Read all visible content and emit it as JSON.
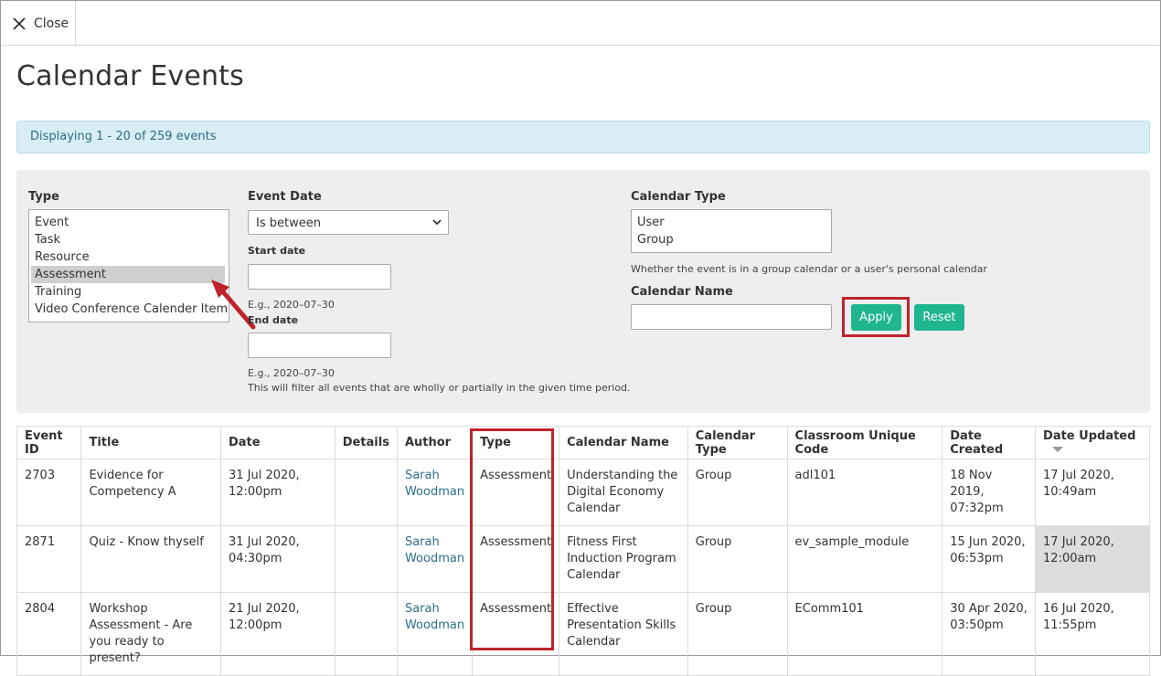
{
  "topbar": {
    "close_label": "Close"
  },
  "page_title": "Calendar Events",
  "info_text": "Displaying 1 - 20 of 259 events",
  "filters": {
    "type": {
      "label": "Type",
      "options": [
        "Event",
        "Task",
        "Resource",
        "Assessment",
        "Training",
        "Video Conference Calender Item"
      ],
      "selected": "Assessment"
    },
    "event_date": {
      "label": "Event Date",
      "operator": "Is between",
      "start_label": "Start date",
      "start_hint": "E.g., 2020–07–30",
      "end_label": "End date",
      "end_hint": "E.g., 2020–07–30",
      "note": "This will filter all events that are wholly or partially in the given time period."
    },
    "calendar_type": {
      "label": "Calendar Type",
      "options": [
        "User",
        "Group"
      ],
      "hint": "Whether the event is in a group calendar or a user's personal calendar"
    },
    "calendar_name": {
      "label": "Calendar Name",
      "value": ""
    },
    "apply_label": "Apply",
    "reset_label": "Reset"
  },
  "table": {
    "columns": [
      "Event ID",
      "Title",
      "Date",
      "Details",
      "Author",
      "Type",
      "Calendar Name",
      "Calendar Type",
      "Classroom Unique Code",
      "Date Created",
      "Date Updated"
    ],
    "sorted_column": "Date Updated",
    "rows": [
      [
        "2703",
        "Evidence for Competency A",
        "31 Jul 2020, 12:00pm",
        "",
        "Sarah Woodman",
        "Assessment",
        "Understanding the Digital Economy Calendar",
        "Group",
        "adl101",
        "18 Nov 2019, 07:32pm",
        "17 Jul 2020, 10:49am"
      ],
      [
        "2871",
        "Quiz - Know thyself",
        "31 Jul 2020, 04:30pm",
        "",
        "Sarah Woodman",
        "Assessment",
        "Fitness First Induction Program Calendar",
        "Group",
        "ev_sample_module",
        "15 Jun 2020, 06:53pm",
        "17 Jul 2020, 12:00am"
      ],
      [
        "2804",
        "Workshop Assessment - Are you ready to present?",
        "21 Jul 2020, 12:00pm",
        "",
        "Sarah Woodman",
        "Assessment",
        "Effective Presentation Skills Calendar",
        "Group",
        "EComm101",
        "30 Apr 2020, 03:50pm",
        "16 Jul 2020, 11:55pm"
      ]
    ]
  },
  "colors": {
    "accent_green": "#1fb58f",
    "highlight_red": "#c0232b",
    "info_bg": "#d8eef4",
    "link": "#2a6e8c"
  }
}
